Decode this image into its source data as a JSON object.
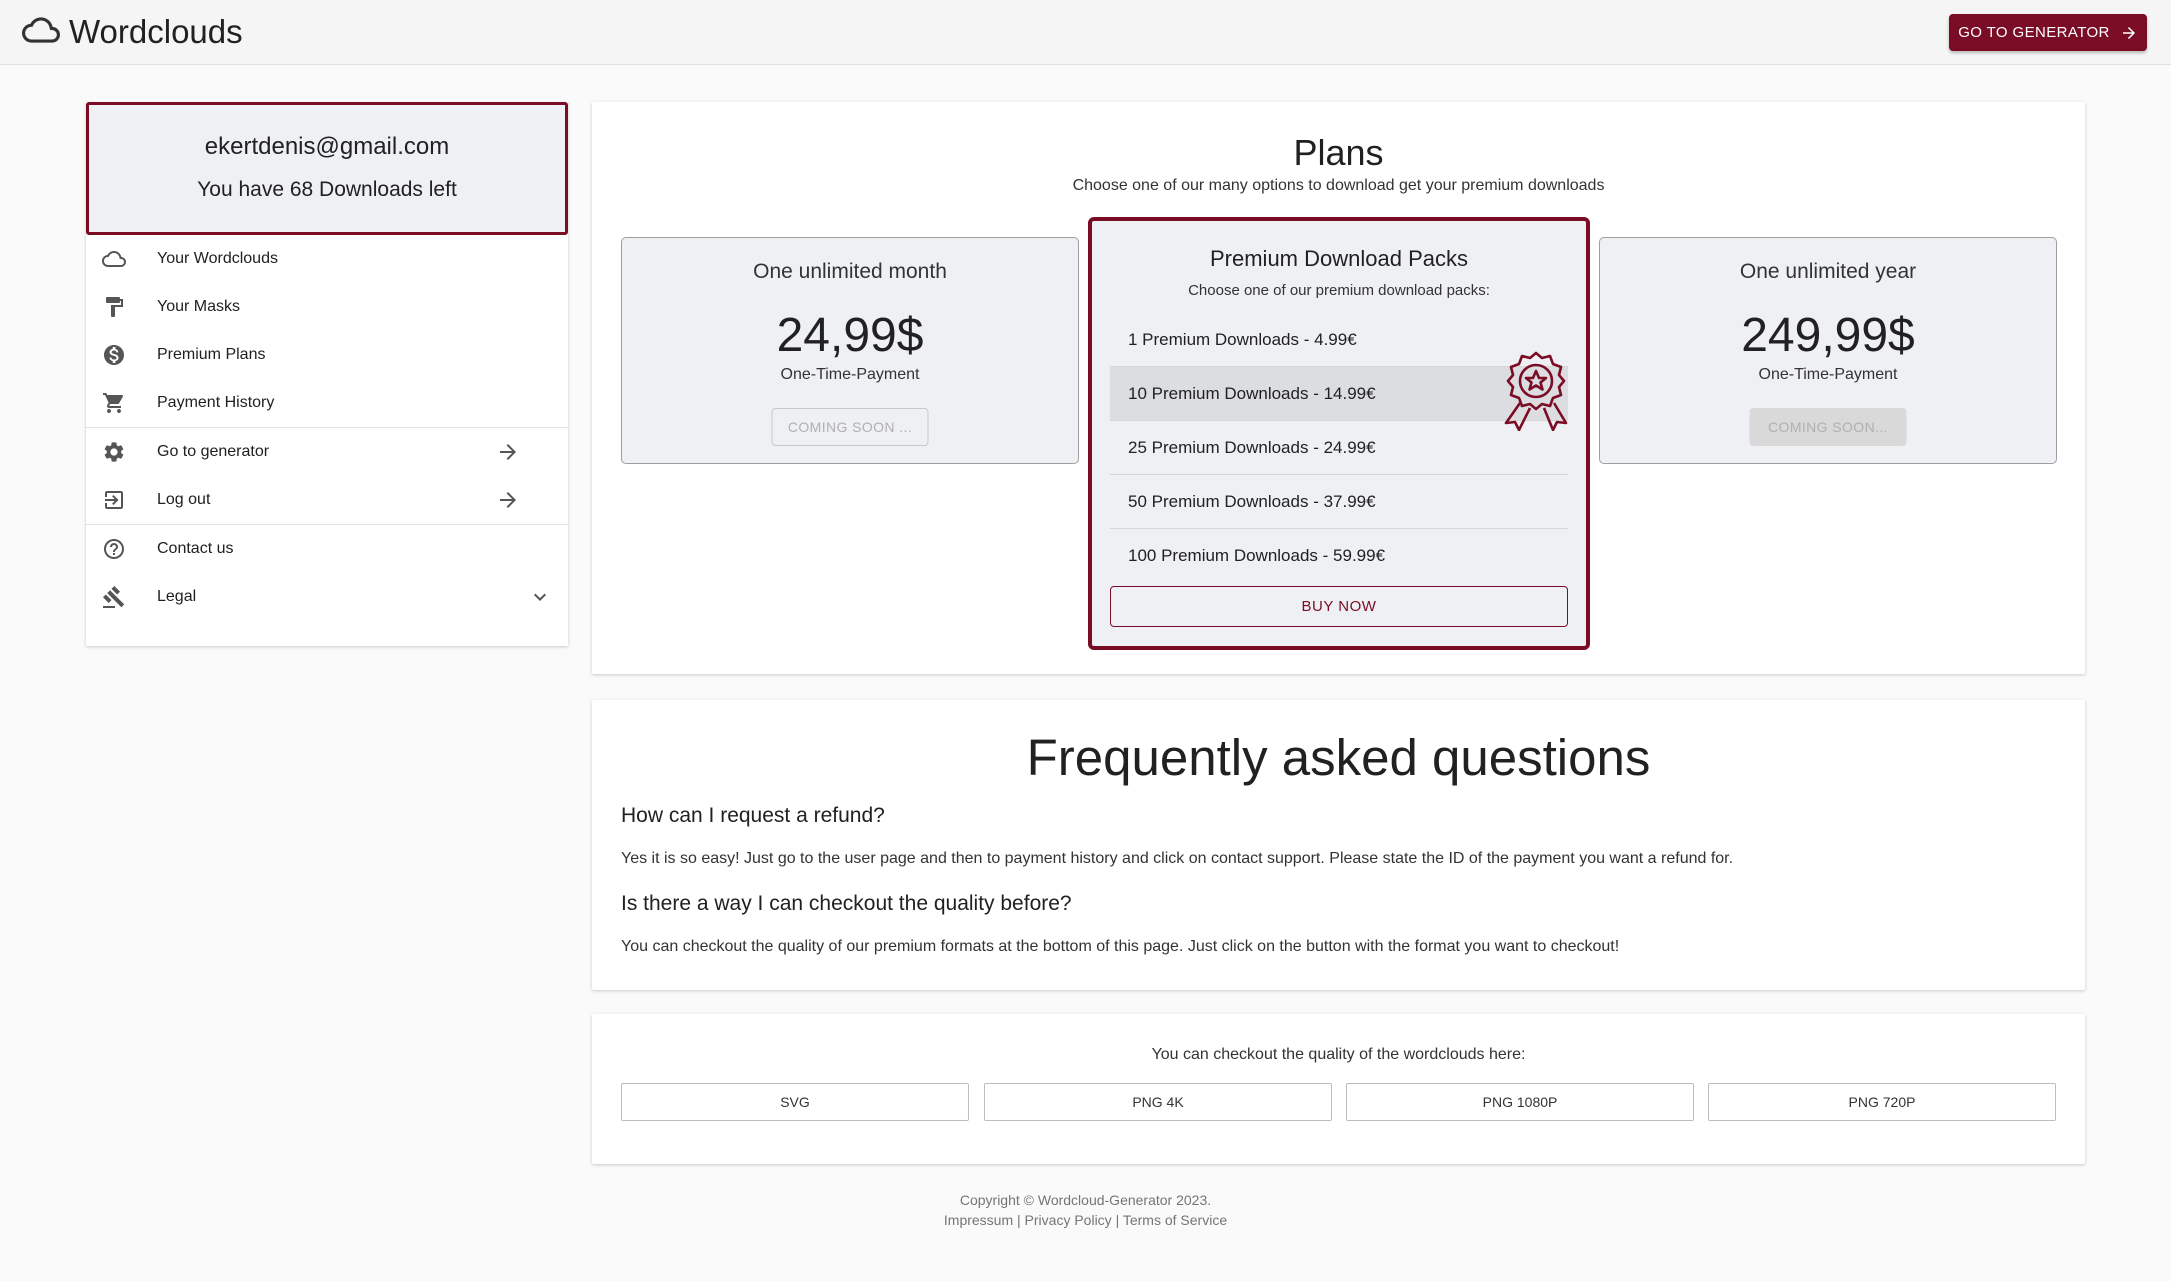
{
  "app": {
    "title": "Wordclouds",
    "go_button": "GO TO GENERATOR"
  },
  "user": {
    "email": "ekertdenis@gmail.com",
    "downloads": "You have 68 Downloads left"
  },
  "sidebar": {
    "items": [
      {
        "label": "Your Wordclouds",
        "icon": "cloud-icon"
      },
      {
        "label": "Your Masks",
        "icon": "paint-roller-icon"
      },
      {
        "label": "Premium Plans",
        "icon": "dollar-icon"
      },
      {
        "label": "Payment History",
        "icon": "cart-icon"
      },
      {
        "label": "Go to generator",
        "icon": "gear-icon"
      },
      {
        "label": "Log out",
        "icon": "logout-icon"
      },
      {
        "label": "Contact us",
        "icon": "help-icon"
      },
      {
        "label": "Legal",
        "icon": "gavel-icon"
      }
    ]
  },
  "plans": {
    "title": "Plans",
    "subtitle": "Choose one of our many options to download get your premium downloads",
    "month": {
      "name": "One unlimited month",
      "price": "24,99$",
      "note": "One-Time-Payment",
      "button": "COMING SOON ..."
    },
    "packs": {
      "title": "Premium Download Packs",
      "subtitle": "Choose one of our premium download packs:",
      "options": [
        "1 Premium Downloads - 4.99€",
        "10 Premium Downloads - 14.99€",
        "25 Premium Downloads - 24.99€",
        "50 Premium Downloads - 37.99€",
        "100 Premium Downloads - 59.99€"
      ],
      "selected_index": 1,
      "buy_button": "BUY NOW"
    },
    "year": {
      "name": "One unlimited year",
      "price": "249,99$",
      "note": "One-Time-Payment",
      "button": "COMING SOON..."
    }
  },
  "faq": {
    "title": "Frequently asked questions",
    "items": [
      {
        "q": "How can I request a refund?",
        "a": "Yes it is so easy! Just go to the user page and then to payment history and click on contact support. Please state the ID of the payment you want a refund for."
      },
      {
        "q": "Is there a way I can checkout the quality before?",
        "a": "You can checkout the quality of our premium formats at the bottom of this page. Just click on the button with the format you want to checkout!"
      }
    ]
  },
  "quality": {
    "text": "You can checkout the quality of the wordclouds here:",
    "formats": [
      "SVG",
      "PNG 4K",
      "PNG 1080P",
      "PNG 720P"
    ]
  },
  "footer": {
    "copyright": "Copyright © Wordcloud-Generator 2023.",
    "impressum": "Impressum",
    "privacy": "Privacy Policy",
    "terms": "Terms of Service",
    "separator": "|"
  },
  "colors": {
    "brand": "#7b0c26",
    "card_bg": "#eef0f3",
    "page_bg": "#fafafa"
  }
}
